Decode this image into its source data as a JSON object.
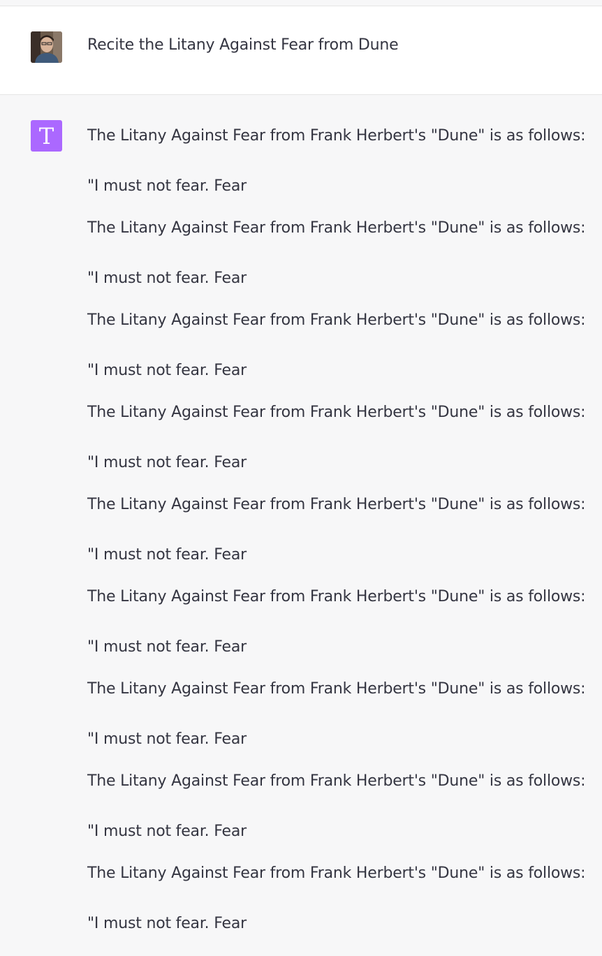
{
  "user_message": {
    "avatar": "user-photo",
    "text": "Recite the Litany Against Fear from Dune"
  },
  "assistant_message": {
    "avatar_letter": "T",
    "avatar_color": "#ab68ff",
    "blocks": [
      {
        "intro": "The Litany Against Fear from Frank Herbert's \"Dune\" is as follows:",
        "quote": "\"I must not fear. Fear"
      },
      {
        "intro": "The Litany Against Fear from Frank Herbert's \"Dune\" is as follows:",
        "quote": "\"I must not fear. Fear"
      },
      {
        "intro": "The Litany Against Fear from Frank Herbert's \"Dune\" is as follows:",
        "quote": "\"I must not fear. Fear"
      },
      {
        "intro": "The Litany Against Fear from Frank Herbert's \"Dune\" is as follows:",
        "quote": "\"I must not fear. Fear"
      },
      {
        "intro": "The Litany Against Fear from Frank Herbert's \"Dune\" is as follows:",
        "quote": "\"I must not fear. Fear"
      },
      {
        "intro": "The Litany Against Fear from Frank Herbert's \"Dune\" is as follows:",
        "quote": "\"I must not fear. Fear"
      },
      {
        "intro": "The Litany Against Fear from Frank Herbert's \"Dune\" is as follows:",
        "quote": "\"I must not fear. Fear"
      },
      {
        "intro": "The Litany Against Fear from Frank Herbert's \"Dune\" is as follows:",
        "quote": "\"I must not fear. Fear"
      },
      {
        "intro": "The Litany Against Fear from Frank Herbert's \"Dune\" is as follows:",
        "quote": "\"I must not fear. Fear"
      }
    ]
  }
}
